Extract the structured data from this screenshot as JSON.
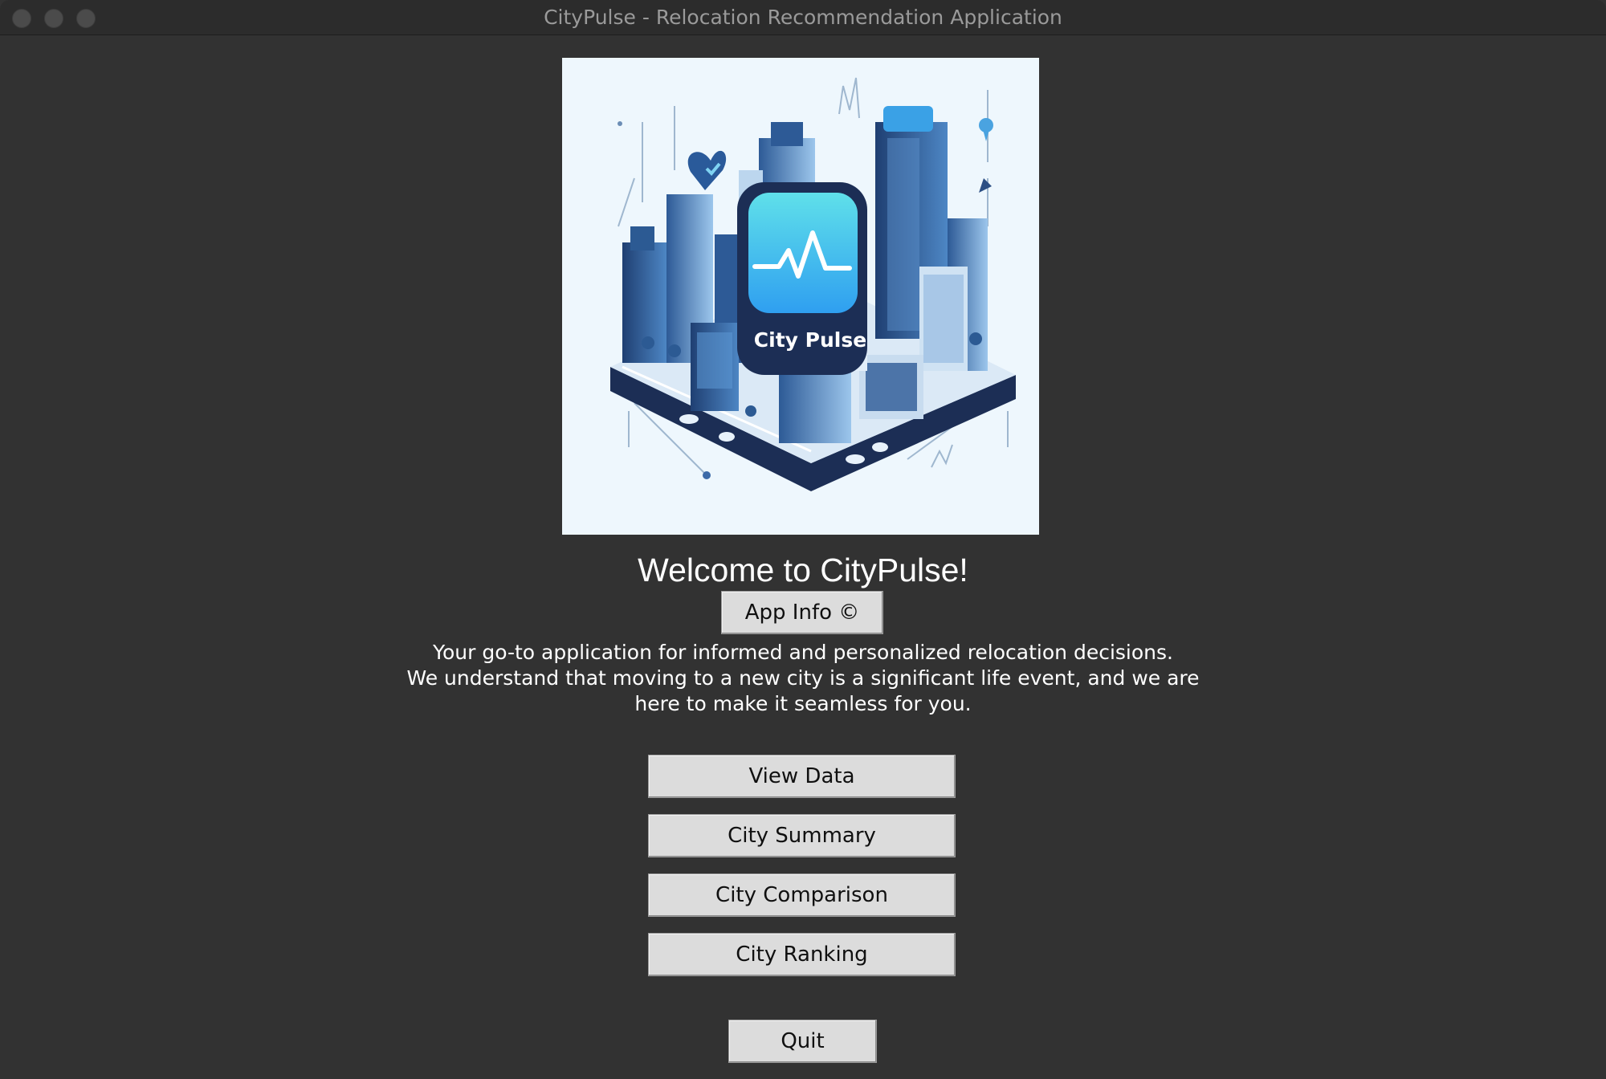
{
  "window": {
    "title": "CityPulse - Relocation Recommendation Application"
  },
  "logo": {
    "caption": "City Pulse",
    "icon": "pulse-app-icon",
    "colors": {
      "background": "#eef7fd",
      "navy": "#1c2e55",
      "tile_top": "#5fe0ea",
      "tile_bottom": "#2f9ff0"
    }
  },
  "welcome": {
    "title": "Welcome to CityPulse!"
  },
  "app_info_button": {
    "label": "App Info ©"
  },
  "description": {
    "lines": [
      "Your go-to application for informed and personalized relocation decisions.",
      "We understand that moving to a new city is a significant life event, and we are",
      "here to make it seamless for you."
    ]
  },
  "menu": {
    "view_data": "View Data",
    "city_summary": "City Summary",
    "city_comparison": "City Comparison",
    "city_ranking": "City Ranking",
    "quit": "Quit"
  }
}
